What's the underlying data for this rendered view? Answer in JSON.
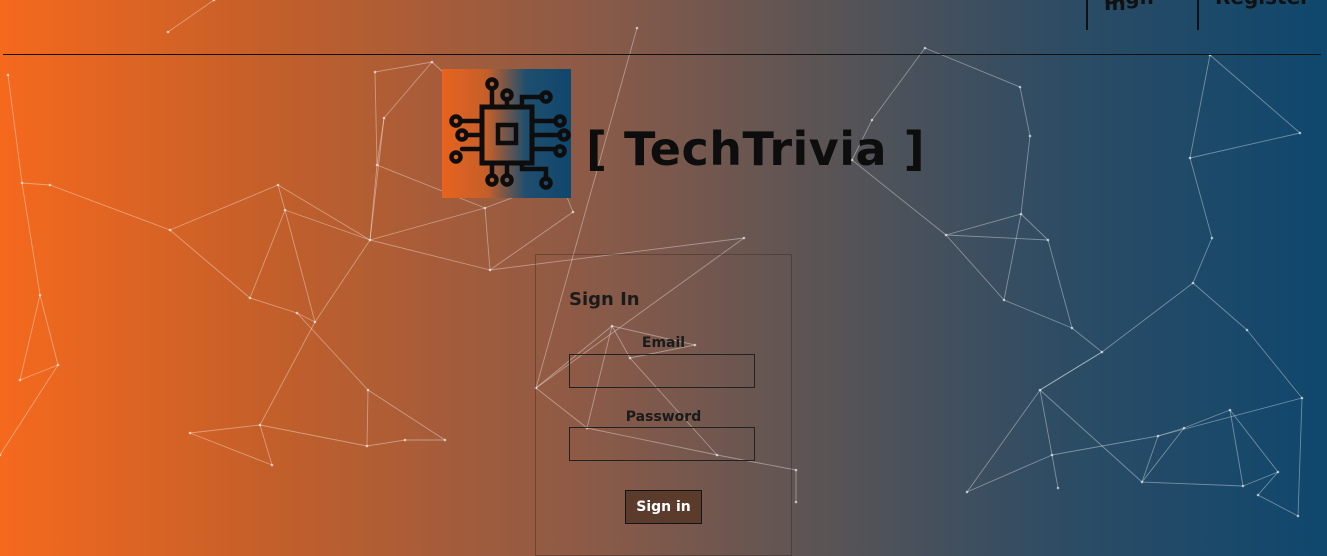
{
  "nav": {
    "signin": "Sign In",
    "register": "Register"
  },
  "brand": {
    "title": "[ TechTrivia ]"
  },
  "form": {
    "title": "Sign In",
    "email_label": "Email",
    "email_value": "",
    "password_label": "Password",
    "password_value": "",
    "submit_label": "Sign in"
  },
  "icons": {
    "logo": "microchip-icon",
    "background": "network-lines"
  },
  "colors": {
    "gradient_left": "#f5691d",
    "gradient_right": "#0f476d",
    "button": "#5a3b2c"
  }
}
